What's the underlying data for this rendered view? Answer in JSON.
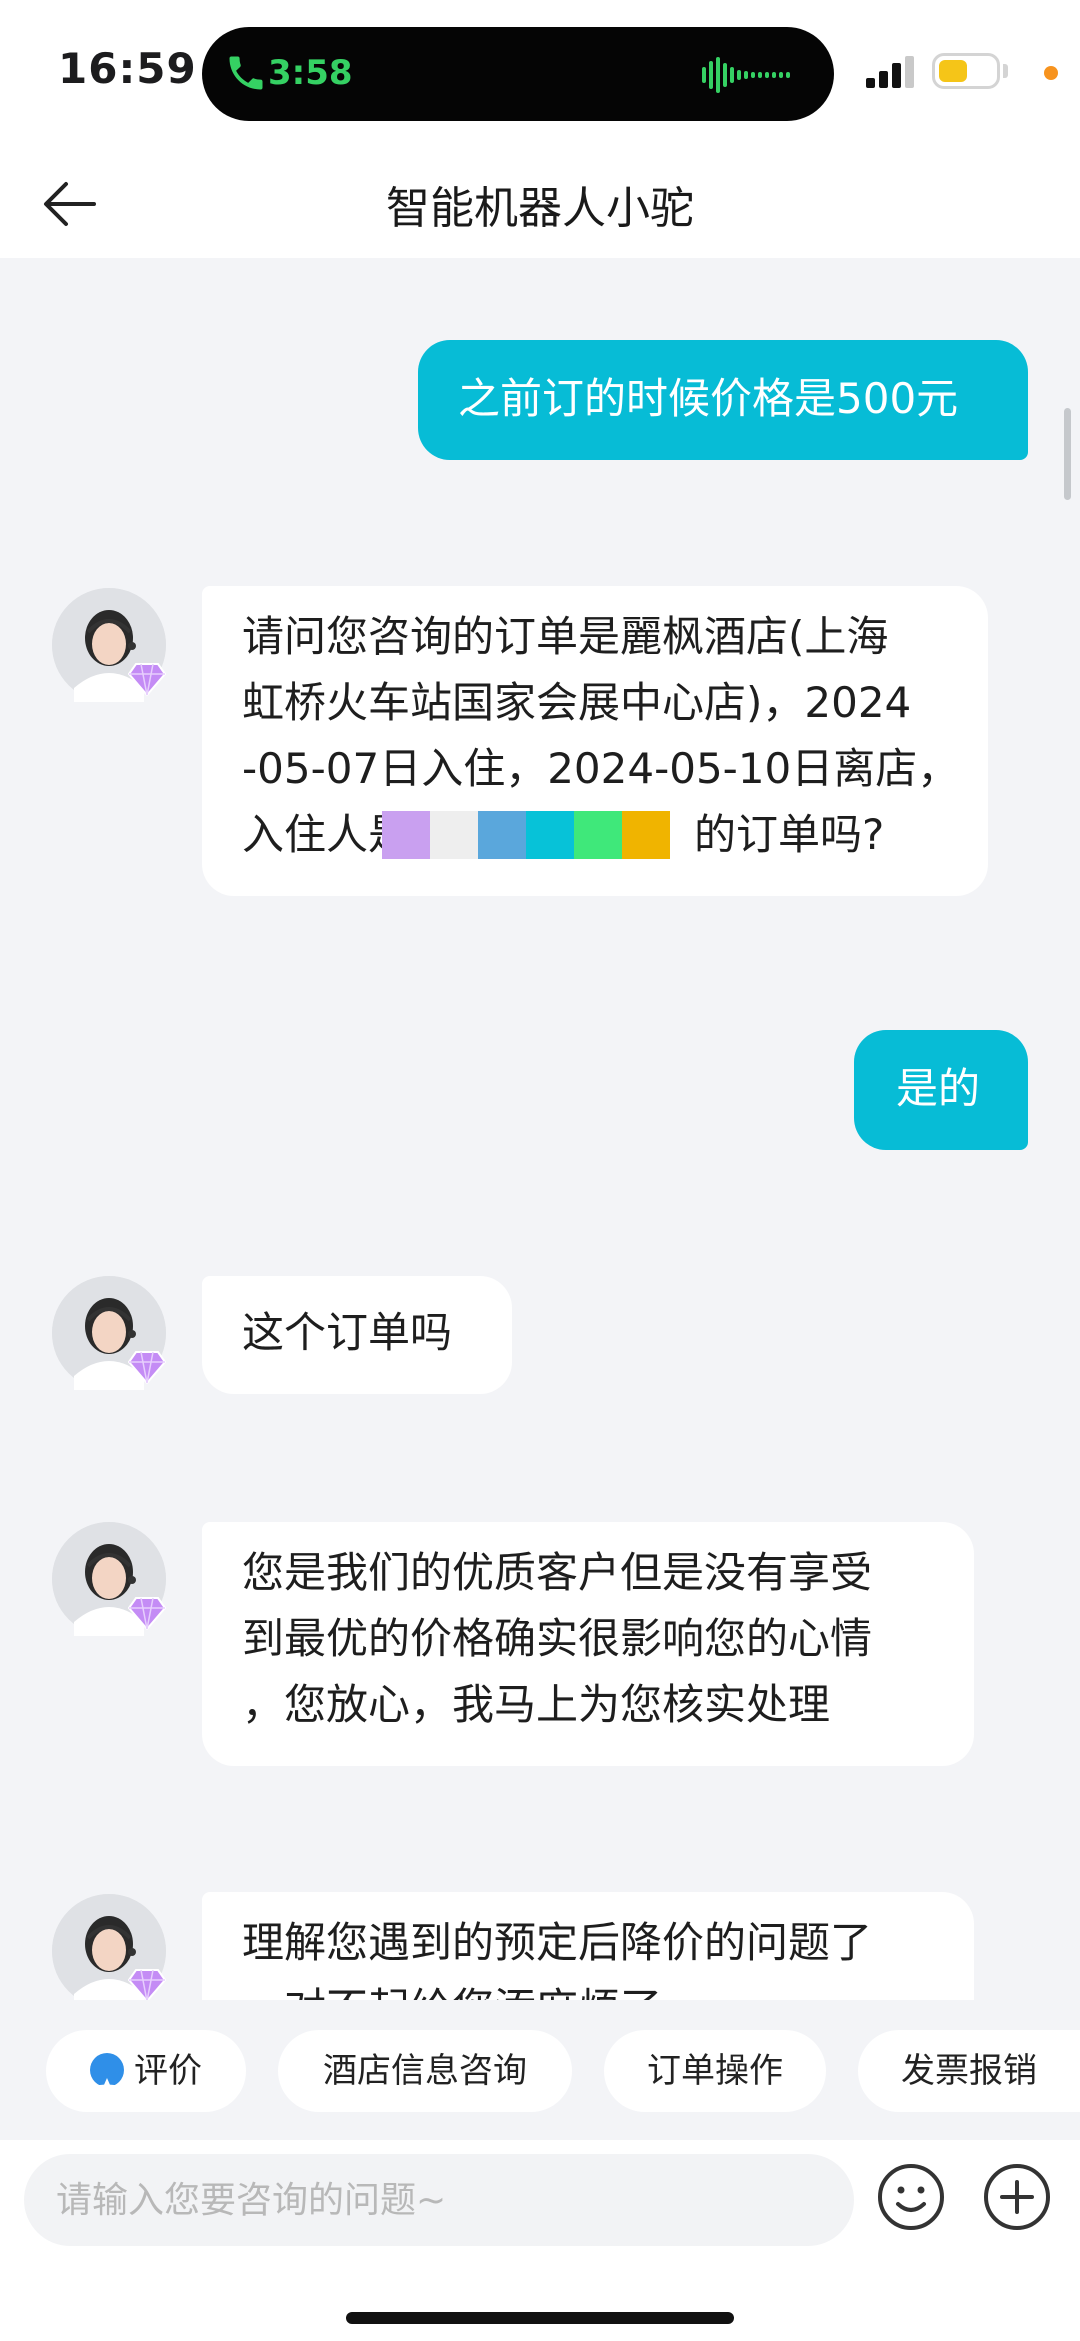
{
  "status_bar": {
    "time": "16:59",
    "call_duration": "3:58",
    "call_color": "#35d163",
    "battery_color": "#f5c518"
  },
  "header": {
    "title": "智能机器人小驼"
  },
  "messages": [
    {
      "role": "user",
      "text": "之前订的时候价格是500元"
    },
    {
      "role": "bot",
      "lines": [
        "请问您咨询的订单是麗枫酒店(上海",
        "虹桥火车站国家会展中心店)，2024",
        "-05-07日入住，2024-05-10日离店，",
        "入住人是",
        "的订单吗?"
      ]
    },
    {
      "role": "user",
      "text": "是的"
    },
    {
      "role": "bot",
      "text": "这个订单吗"
    },
    {
      "role": "bot",
      "lines": [
        "您是我们的优质客户但是没有享受",
        "到最优的价格确实很影响您的心情",
        "，您放心，我马上为您核实处理"
      ]
    },
    {
      "role": "bot",
      "lines": [
        "理解您遇到的预定后降价的问题了",
        "，对不起给您添麻烦了"
      ]
    }
  ],
  "redaction_colors": [
    "#c9a0f0",
    "#eeeeee",
    "#5aa7dc",
    "#07c2d8",
    "#3fe87a",
    "#f0b400"
  ],
  "chips": [
    {
      "label": "评价",
      "icon": "star-icon"
    },
    {
      "label": "酒店信息咨询"
    },
    {
      "label": "订单操作"
    },
    {
      "label": "发票报销"
    }
  ],
  "input": {
    "placeholder": "请输入您要咨询的问题~"
  },
  "colors": {
    "accent": "#07bcd6",
    "background": "#f3f4f7"
  }
}
